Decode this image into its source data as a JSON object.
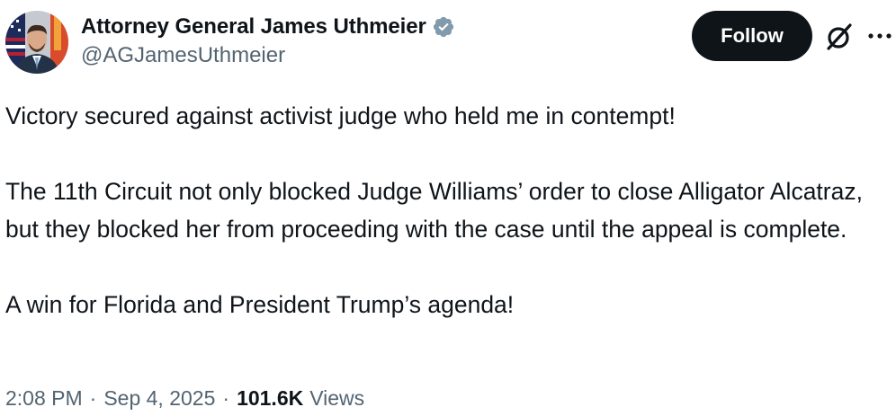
{
  "author": {
    "display_name": "Attorney General James Uthmeier",
    "handle": "@AGJamesUthmeier",
    "verified": true
  },
  "actions": {
    "follow_label": "Follow",
    "grok_icon": "grok-icon",
    "more_icon": "more-icon"
  },
  "tweet": {
    "paragraphs": [
      "Victory secured against activist judge who held me in contempt!",
      "The 11th Circuit not only blocked Judge Williams’ order to close Alligator Alcatraz, but they blocked her from proceeding with the case until the appeal is complete.",
      "A win for Florida and President Trump’s agenda!"
    ]
  },
  "meta": {
    "time": "2:08 PM",
    "date": "Sep 4, 2025",
    "separator": "·",
    "views_count": "101.6K",
    "views_label": "Views"
  },
  "colors": {
    "text": "#0f1419",
    "secondary": "#536471",
    "verified_badge": "#829aab",
    "follow_bg": "#0f1419"
  }
}
